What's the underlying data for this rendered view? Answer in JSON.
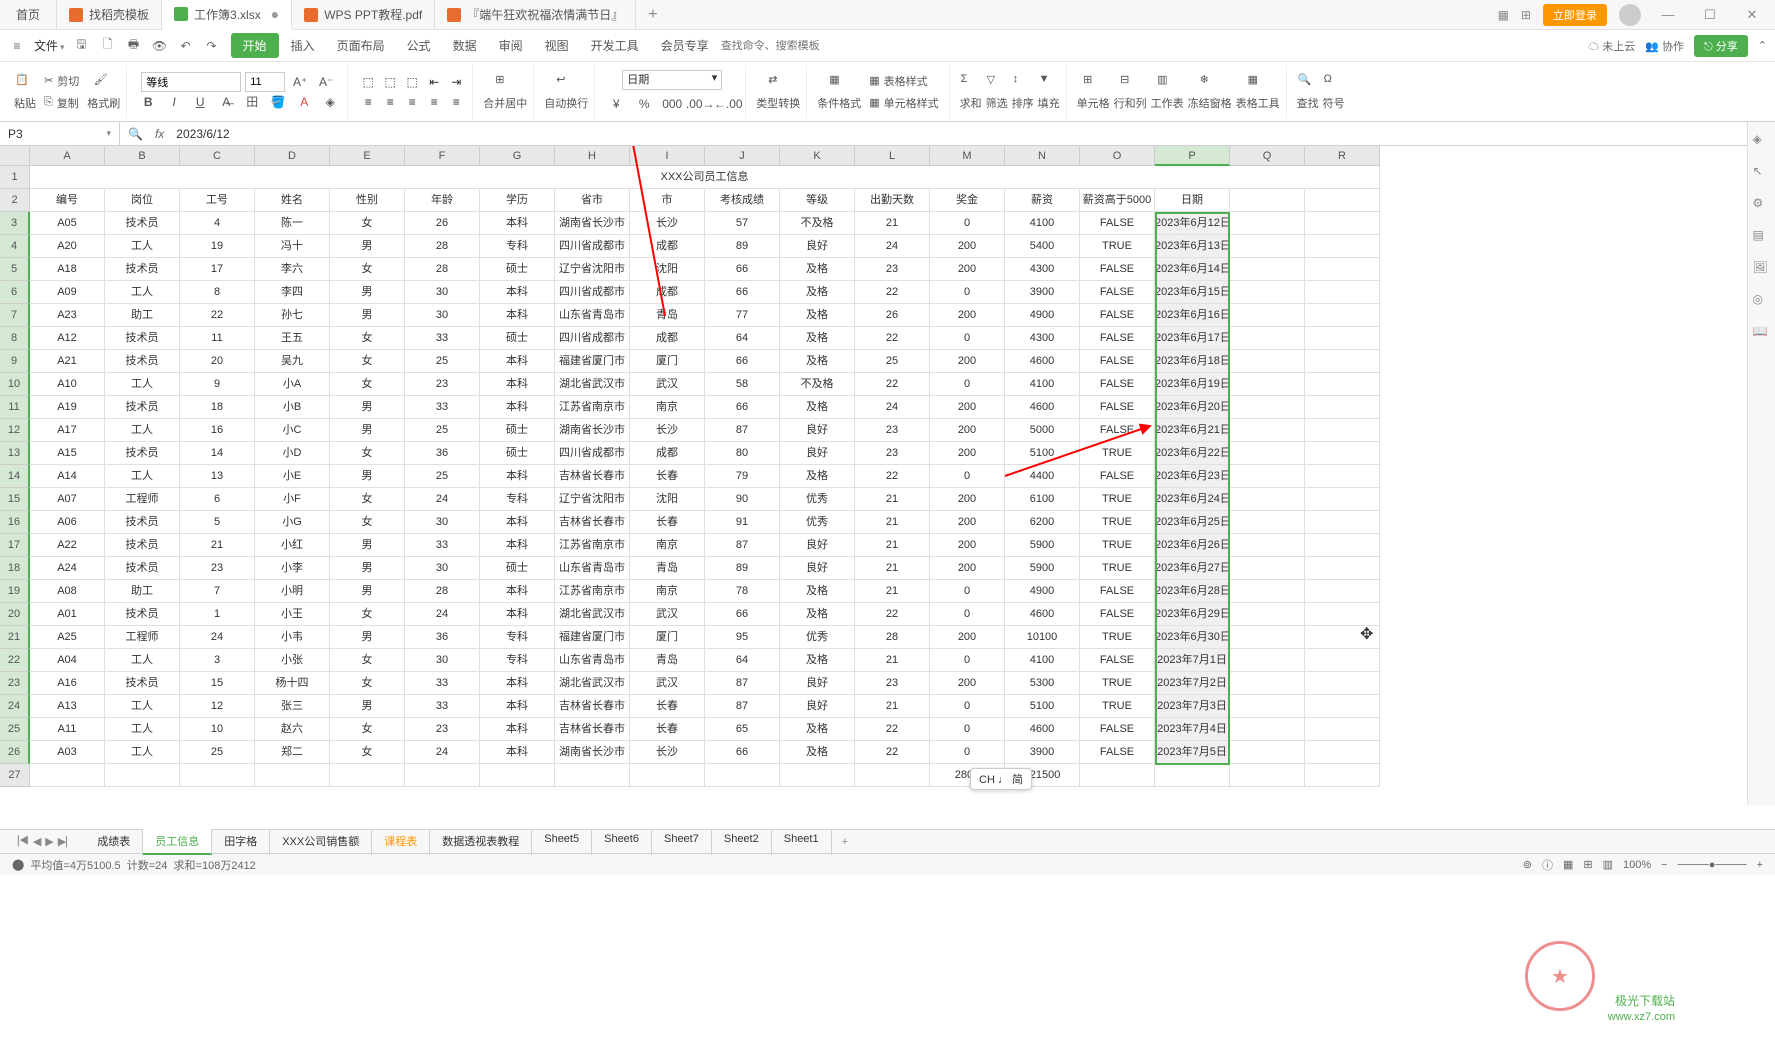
{
  "titlebar": {
    "home": "首页",
    "tabs": [
      {
        "icon": "doc",
        "label": "找稻壳模板",
        "color": "#e86c2e"
      },
      {
        "icon": "xls",
        "label": "工作簿3.xlsx",
        "color": "#4daf4e",
        "active": true
      },
      {
        "icon": "pdf",
        "label": "WPS PPT教程.pdf",
        "color": "#e86c2e"
      },
      {
        "icon": "ppt",
        "label": "『端午狂欢祝福浓情满节日』",
        "color": "#e86c2e"
      }
    ],
    "login": "立即登录"
  },
  "menubar": {
    "file": "文件",
    "tabs": [
      "开始",
      "插入",
      "页面布局",
      "公式",
      "数据",
      "审阅",
      "视图",
      "开发工具",
      "会员专享"
    ],
    "search_placeholder": "查找命令、搜索模板",
    "cloud": "未上云",
    "coop": "协作",
    "share": "分享"
  },
  "ribbon": {
    "paste": "粘贴",
    "cut": "剪切",
    "copy": "复制",
    "format_painter": "格式刷",
    "font_name": "等线",
    "font_size": "11",
    "merge": "合并居中",
    "wrap": "自动换行",
    "number_format": "日期",
    "type_convert": "类型转换",
    "cond_fmt": "条件格式",
    "table_style": "表格样式",
    "cell_style": "单元格样式",
    "sum": "求和",
    "filter": "筛选",
    "sort": "排序",
    "fill": "填充",
    "cell": "单元格",
    "rowcol": "行和列",
    "sheet": "工作表",
    "freeze": "冻结窗格",
    "table_tools": "表格工具",
    "find": "查找",
    "symbol": "符号"
  },
  "formula_bar": {
    "name_box": "P3",
    "formula": "2023/6/12"
  },
  "columns": [
    "A",
    "B",
    "C",
    "D",
    "E",
    "F",
    "G",
    "H",
    "I",
    "J",
    "K",
    "L",
    "M",
    "N",
    "O",
    "P",
    "Q",
    "R"
  ],
  "title_row": "XXX公司员工信息",
  "headers": [
    "编号",
    "岗位",
    "工号",
    "姓名",
    "性别",
    "年龄",
    "学历",
    "省市",
    "市",
    "考核成绩",
    "等级",
    "出勤天数",
    "奖金",
    "薪资",
    "薪资高于5000",
    "日期"
  ],
  "rows": [
    [
      "A05",
      "技术员",
      "4",
      "陈一",
      "女",
      "26",
      "本科",
      "湖南省长沙市",
      "长沙",
      "57",
      "不及格",
      "21",
      "0",
      "4100",
      "FALSE",
      "2023年6月12日"
    ],
    [
      "A20",
      "工人",
      "19",
      "冯十",
      "男",
      "28",
      "专科",
      "四川省成都市",
      "成都",
      "89",
      "良好",
      "24",
      "200",
      "5400",
      "TRUE",
      "2023年6月13日"
    ],
    [
      "A18",
      "技术员",
      "17",
      "李六",
      "女",
      "28",
      "硕士",
      "辽宁省沈阳市",
      "沈阳",
      "66",
      "及格",
      "23",
      "200",
      "4300",
      "FALSE",
      "2023年6月14日"
    ],
    [
      "A09",
      "工人",
      "8",
      "李四",
      "男",
      "30",
      "本科",
      "四川省成都市",
      "成都",
      "66",
      "及格",
      "22",
      "0",
      "3900",
      "FALSE",
      "2023年6月15日"
    ],
    [
      "A23",
      "助工",
      "22",
      "孙七",
      "男",
      "30",
      "本科",
      "山东省青岛市",
      "青岛",
      "77",
      "及格",
      "26",
      "200",
      "4900",
      "FALSE",
      "2023年6月16日"
    ],
    [
      "A12",
      "技术员",
      "11",
      "王五",
      "女",
      "33",
      "硕士",
      "四川省成都市",
      "成都",
      "64",
      "及格",
      "22",
      "0",
      "4300",
      "FALSE",
      "2023年6月17日"
    ],
    [
      "A21",
      "技术员",
      "20",
      "吴九",
      "女",
      "25",
      "本科",
      "福建省厦门市",
      "厦门",
      "66",
      "及格",
      "25",
      "200",
      "4600",
      "FALSE",
      "2023年6月18日"
    ],
    [
      "A10",
      "工人",
      "9",
      "小A",
      "女",
      "23",
      "本科",
      "湖北省武汉市",
      "武汉",
      "58",
      "不及格",
      "22",
      "0",
      "4100",
      "FALSE",
      "2023年6月19日"
    ],
    [
      "A19",
      "技术员",
      "18",
      "小B",
      "男",
      "33",
      "本科",
      "江苏省南京市",
      "南京",
      "66",
      "及格",
      "24",
      "200",
      "4600",
      "FALSE",
      "2023年6月20日"
    ],
    [
      "A17",
      "工人",
      "16",
      "小C",
      "男",
      "25",
      "硕士",
      "湖南省长沙市",
      "长沙",
      "87",
      "良好",
      "23",
      "200",
      "5000",
      "FALSE",
      "2023年6月21日"
    ],
    [
      "A15",
      "技术员",
      "14",
      "小D",
      "女",
      "36",
      "硕士",
      "四川省成都市",
      "成都",
      "80",
      "良好",
      "23",
      "200",
      "5100",
      "TRUE",
      "2023年6月22日"
    ],
    [
      "A14",
      "工人",
      "13",
      "小E",
      "男",
      "25",
      "本科",
      "吉林省长春市",
      "长春",
      "79",
      "及格",
      "22",
      "0",
      "4400",
      "FALSE",
      "2023年6月23日"
    ],
    [
      "A07",
      "工程师",
      "6",
      "小F",
      "女",
      "24",
      "专科",
      "辽宁省沈阳市",
      "沈阳",
      "90",
      "优秀",
      "21",
      "200",
      "6100",
      "TRUE",
      "2023年6月24日"
    ],
    [
      "A06",
      "技术员",
      "5",
      "小G",
      "女",
      "30",
      "本科",
      "吉林省长春市",
      "长春",
      "91",
      "优秀",
      "21",
      "200",
      "6200",
      "TRUE",
      "2023年6月25日"
    ],
    [
      "A22",
      "技术员",
      "21",
      "小红",
      "男",
      "33",
      "本科",
      "江苏省南京市",
      "南京",
      "87",
      "良好",
      "21",
      "200",
      "5900",
      "TRUE",
      "2023年6月26日"
    ],
    [
      "A24",
      "技术员",
      "23",
      "小李",
      "男",
      "30",
      "硕士",
      "山东省青岛市",
      "青岛",
      "89",
      "良好",
      "21",
      "200",
      "5900",
      "TRUE",
      "2023年6月27日"
    ],
    [
      "A08",
      "助工",
      "7",
      "小明",
      "男",
      "28",
      "本科",
      "江苏省南京市",
      "南京",
      "78",
      "及格",
      "21",
      "0",
      "4900",
      "FALSE",
      "2023年6月28日"
    ],
    [
      "A01",
      "技术员",
      "1",
      "小王",
      "女",
      "24",
      "本科",
      "湖北省武汉市",
      "武汉",
      "66",
      "及格",
      "22",
      "0",
      "4600",
      "FALSE",
      "2023年6月29日"
    ],
    [
      "A25",
      "工程师",
      "24",
      "小韦",
      "男",
      "36",
      "专科",
      "福建省厦门市",
      "厦门",
      "95",
      "优秀",
      "28",
      "200",
      "10100",
      "TRUE",
      "2023年6月30日"
    ],
    [
      "A04",
      "工人",
      "3",
      "小张",
      "女",
      "30",
      "专科",
      "山东省青岛市",
      "青岛",
      "64",
      "及格",
      "21",
      "0",
      "4100",
      "FALSE",
      "2023年7月1日"
    ],
    [
      "A16",
      "技术员",
      "15",
      "杨十四",
      "女",
      "33",
      "本科",
      "湖北省武汉市",
      "武汉",
      "87",
      "良好",
      "23",
      "200",
      "5300",
      "TRUE",
      "2023年7月2日"
    ],
    [
      "A13",
      "工人",
      "12",
      "张三",
      "男",
      "33",
      "本科",
      "吉林省长春市",
      "长春",
      "87",
      "良好",
      "21",
      "0",
      "5100",
      "TRUE",
      "2023年7月3日"
    ],
    [
      "A11",
      "工人",
      "10",
      "赵六",
      "女",
      "23",
      "本科",
      "吉林省长春市",
      "长春",
      "65",
      "及格",
      "22",
      "0",
      "4600",
      "FALSE",
      "2023年7月4日"
    ],
    [
      "A03",
      "工人",
      "25",
      "郑二",
      "女",
      "24",
      "本科",
      "湖南省长沙市",
      "长沙",
      "66",
      "及格",
      "22",
      "0",
      "3900",
      "FALSE",
      "2023年7月5日"
    ]
  ],
  "bottom_totals": {
    "col_m": "2800",
    "col_n": "121500"
  },
  "ime": "CH ♩ 简",
  "sheets": [
    "成绩表",
    "员工信息",
    "田字格",
    "XXX公司销售额",
    "课程表",
    "数据透视表教程",
    "Sheet5",
    "Sheet6",
    "Sheet7",
    "Sheet2",
    "Sheet1"
  ],
  "active_sheet": "员工信息",
  "orange_sheet": "课程表",
  "statusbar": {
    "avg": "平均值=4万5100.5",
    "count": "计数=24",
    "sum": "求和=108万2412",
    "zoom": "100%"
  },
  "watermark": {
    "brand": "极光下载站",
    "url": "www.xz7.com"
  }
}
